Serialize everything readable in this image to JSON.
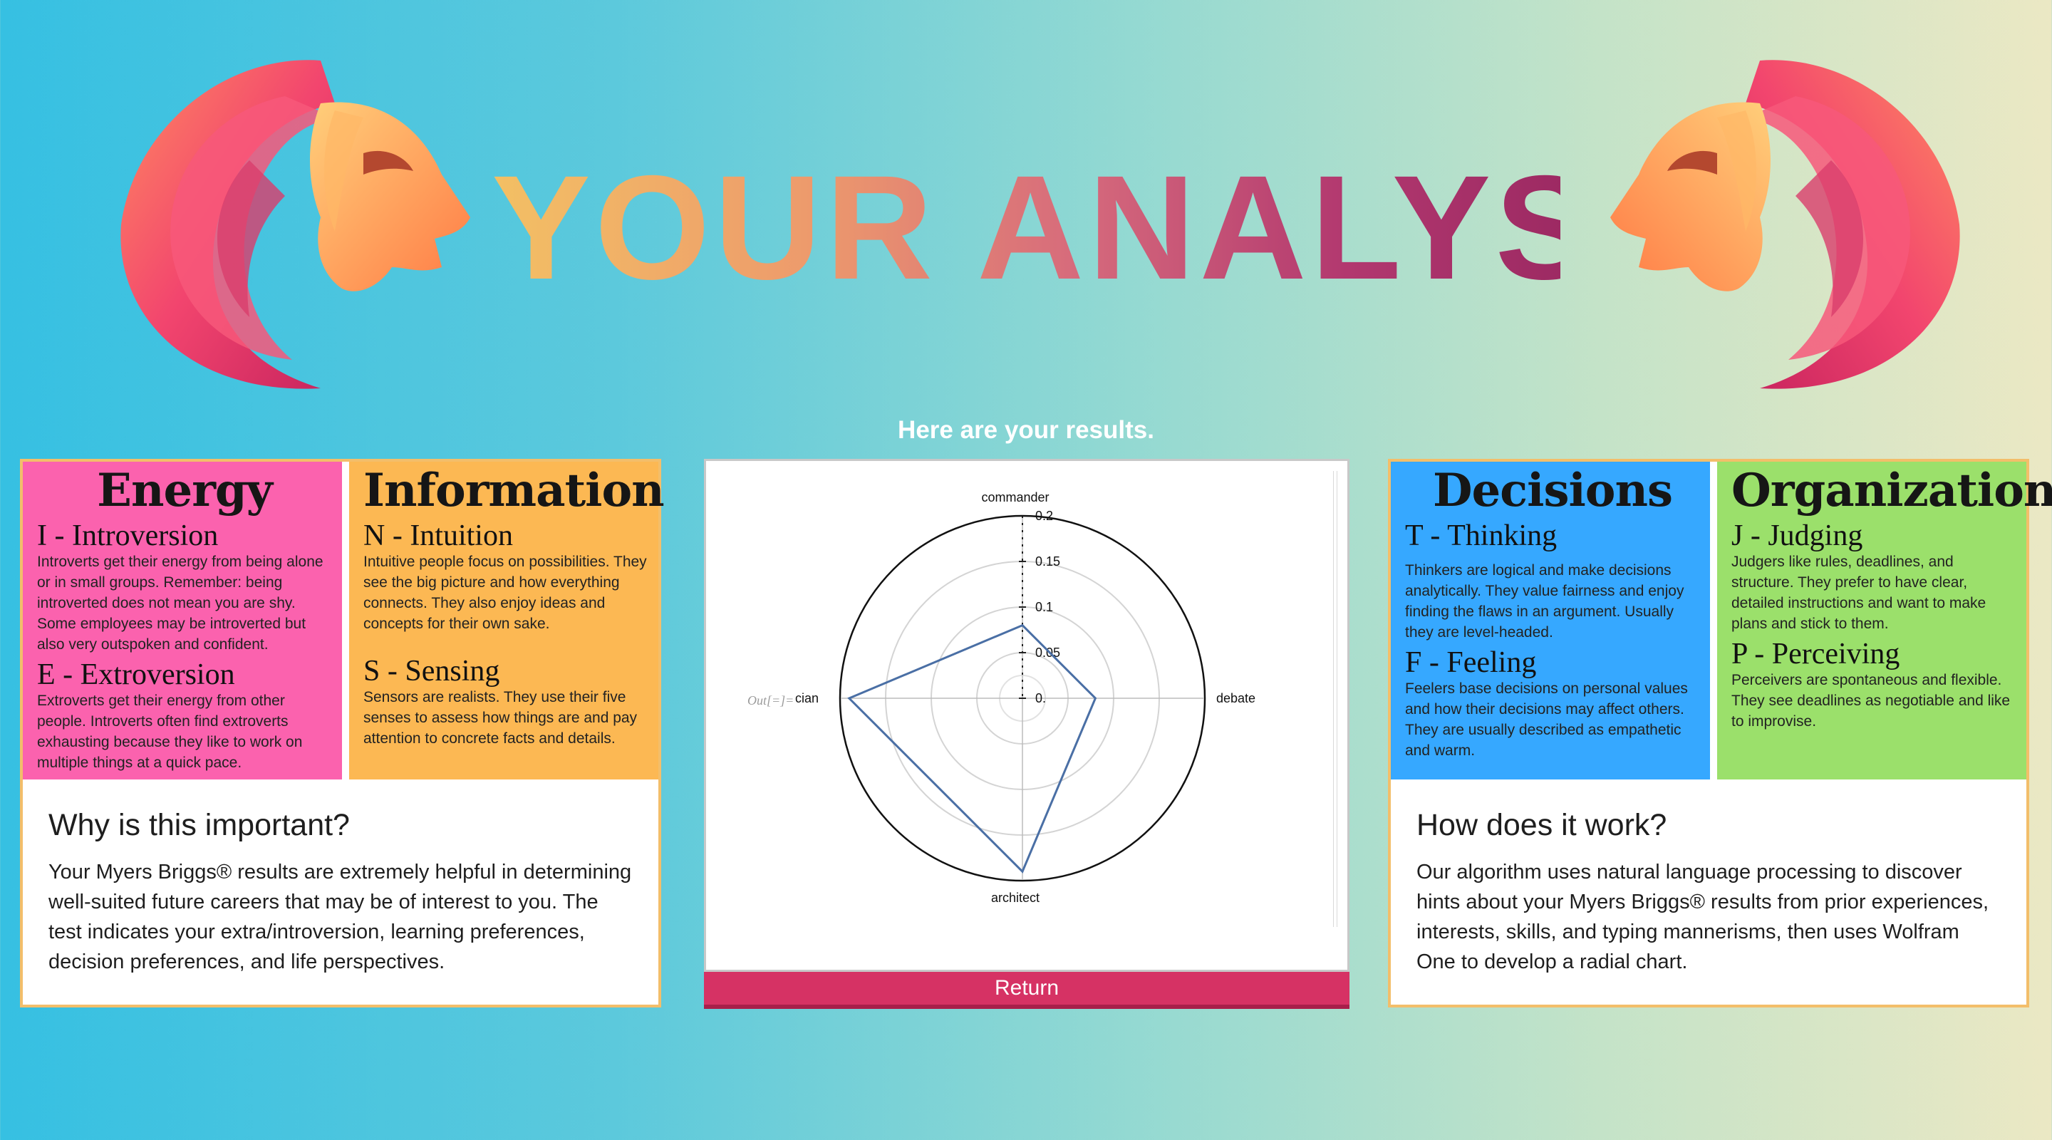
{
  "header": {
    "title": "YOUR ANALYSIS",
    "subtitle": "Here are your results."
  },
  "left_panel": {
    "energy": {
      "heading": "Energy",
      "introversion_title": "I - Introversion",
      "introversion_text": "Introverts get their energy from being alone or in small groups. Remember: being introverted does not mean you are shy. Some employees may be introverted but also very outspoken and confident.",
      "extroversion_title": "E - Extroversion",
      "extroversion_text": "Extroverts get their energy from other people. Introverts often find extroverts exhausting because they like to work on multiple things at a quick pace."
    },
    "information": {
      "heading": "Information",
      "intuition_title": "N - Intuition",
      "intuition_text": "Intuitive people focus on possibilities. They see the big picture and how everything connects. They also enjoy ideas and concepts for their own sake.",
      "sensing_title": "S - Sensing",
      "sensing_text": "Sensors are realists. They use their five senses to assess how things are and pay attention to concrete facts and details."
    },
    "why_title": "Why is this important?",
    "why_text": "Your Myers Briggs® results are extremely helpful in determining well-suited future careers that may be of interest to you. The test indicates your extra/introversion, learning preferences, decision preferences, and life perspectives."
  },
  "right_panel": {
    "decisions": {
      "heading": "Decisions",
      "thinking_title": "T - Thinking",
      "thinking_text": "Thinkers are logical and make decisions analytically. They value fairness and enjoy finding the flaws in an argument. Usually they are level-headed.",
      "feeling_title": "F - Feeling",
      "feeling_text": "Feelers base decisions on personal values and how their decisions may affect others. They are usually described as empathetic and warm."
    },
    "organization": {
      "heading": "Organization",
      "judging_title": "J - Judging",
      "judging_text": "Judgers like rules, deadlines, and structure. They prefer to have clear, detailed instructions and want to make plans and stick to them.",
      "perceiving_title": "P - Perceiving",
      "perceiving_text": "Perceivers are spontaneous and flexible. They see deadlines as negotiable and like to improvise."
    },
    "how_title": "How does it work?",
    "how_text": "Our algorithm uses natural language processing to discover hints about your Myers Briggs® results from prior experiences, interests, skills, and typing mannerisms, then uses Wolfram One to develop a radial chart."
  },
  "chart_data": {
    "type": "radar",
    "categories": [
      "commander",
      "debate",
      "architect",
      "cian"
    ],
    "values": [
      0.08,
      0.08,
      0.19,
      0.19
    ],
    "rlim": [
      0,
      0.2
    ],
    "rticks": [
      "0.",
      "0.05",
      "0.1",
      "0.15",
      "0.2"
    ],
    "out_label": "Out[=]=",
    "line_color": "#4a6fa5"
  },
  "actions": {
    "return_label": "Return"
  }
}
